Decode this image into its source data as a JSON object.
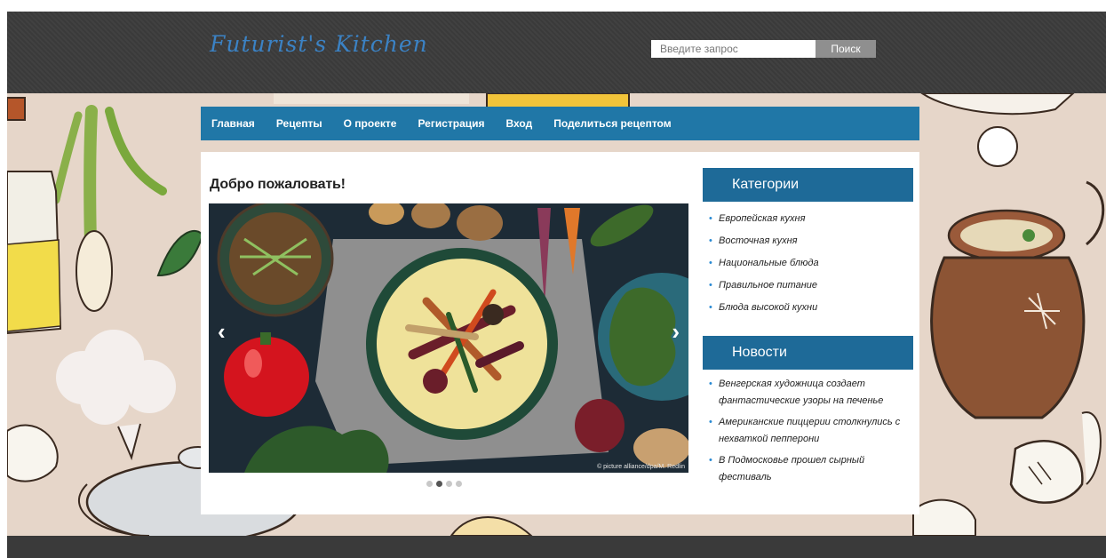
{
  "header": {
    "logo": "Futurist's Kitchen",
    "search": {
      "placeholder": "Введите запрос",
      "button_label": "Поиск"
    }
  },
  "nav": {
    "items": [
      {
        "label": "Главная"
      },
      {
        "label": "Рецепты"
      },
      {
        "label": "О проекте"
      },
      {
        "label": "Регистрация"
      },
      {
        "label": "Вход"
      },
      {
        "label": "Поделиться рецептом"
      }
    ]
  },
  "main": {
    "welcome_title": "Добро пожаловать!",
    "slider": {
      "credit": "© picture alliance/dpa/M. Redlin",
      "prev_icon": "chevron-left-icon",
      "next_icon": "chevron-right-icon",
      "prev_glyph": "‹",
      "next_glyph": "›",
      "slides_total": 4,
      "active_slide": 2
    }
  },
  "sidebar": {
    "categories": {
      "title": "Категории",
      "items": [
        "Европейская кухня",
        "Восточная кухня",
        "Национальные блюда",
        "Правильное питание",
        "Блюда высокой кухни"
      ]
    },
    "news": {
      "title": "Новости",
      "items": [
        "Венгерская художница создает фантастические узоры на печенье",
        "Американские пиццерии столкнулись с нехваткой пепперони",
        "В Подмосковье прошел сырный фестиваль"
      ]
    }
  },
  "colors": {
    "header_bg": "#3a3a3a",
    "nav_bg": "#2077a7",
    "sidebar_heading_bg": "#1e6a98",
    "page_bg": "#e6d6c9",
    "bullet": "#2a8ad3"
  }
}
